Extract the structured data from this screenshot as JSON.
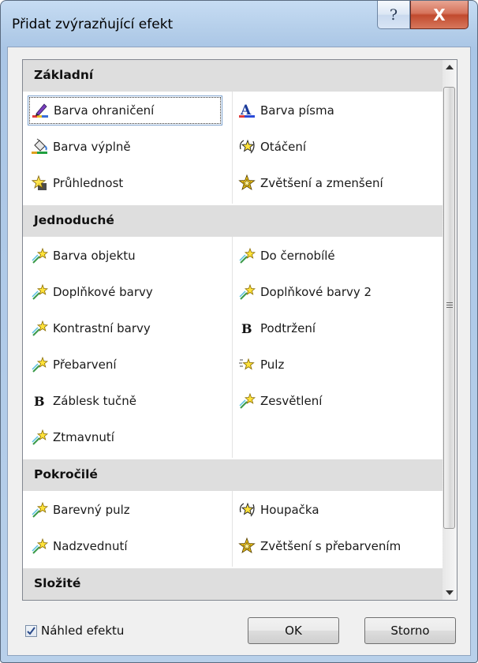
{
  "window": {
    "title": "Přidat zvýrazňující efekt",
    "help_glyph": "?",
    "close_glyph": "X"
  },
  "groups": [
    {
      "name": "Základní",
      "items": [
        {
          "label": "Barva ohraničení",
          "icon": "pen-color-icon"
        },
        {
          "label": "Barva písma",
          "icon": "font-color-icon"
        },
        {
          "label": "Barva výplně",
          "icon": "fill-bucket-icon"
        },
        {
          "label": "Otáčení",
          "icon": "spin-star-icon"
        },
        {
          "label": "Průhlednost",
          "icon": "transparency-star-icon"
        },
        {
          "label": "Zvětšení a zmenšení",
          "icon": "grow-shrink-star-icon"
        }
      ]
    },
    {
      "name": "Jednoduché",
      "items": [
        {
          "label": "Barva objektu",
          "icon": "star-wand-icon"
        },
        {
          "label": "Do černobílé",
          "icon": "star-wand-icon"
        },
        {
          "label": "Doplňkové barvy",
          "icon": "star-wand-icon"
        },
        {
          "label": "Doplňkové barvy 2",
          "icon": "star-wand-icon"
        },
        {
          "label": "Kontrastní barvy",
          "icon": "star-wand-icon"
        },
        {
          "label": "Podtržení",
          "icon": "bold-b-icon"
        },
        {
          "label": "Přebarvení",
          "icon": "star-wand-icon"
        },
        {
          "label": "Pulz",
          "icon": "pulse-star-icon"
        },
        {
          "label": "Záblesk tučně",
          "icon": "bold-b-icon"
        },
        {
          "label": "Zesvětlení",
          "icon": "star-wand-icon"
        },
        {
          "label": "Ztmavnutí",
          "icon": "star-wand-icon"
        }
      ]
    },
    {
      "name": "Pokročilé",
      "items": [
        {
          "label": "Barevný pulz",
          "icon": "star-wand-icon"
        },
        {
          "label": "Houpačka",
          "icon": "spin-star-icon"
        },
        {
          "label": "Nadzvednutí",
          "icon": "star-wand-icon"
        },
        {
          "label": "Zvětšení s přebarvením",
          "icon": "grow-shrink-star-icon"
        }
      ]
    },
    {
      "name": "Složité",
      "items": []
    }
  ],
  "preview": {
    "label": "Náhled efektu",
    "checked": true
  },
  "buttons": {
    "ok": "OK",
    "cancel": "Storno"
  }
}
